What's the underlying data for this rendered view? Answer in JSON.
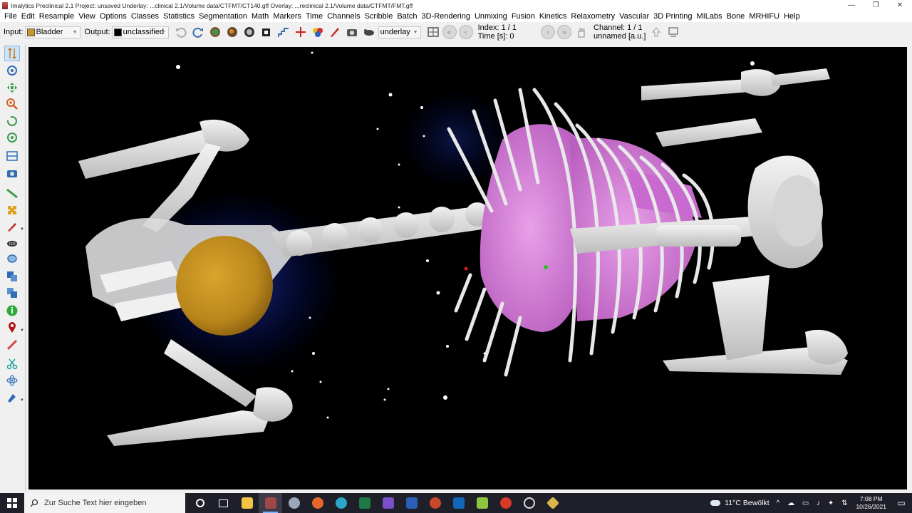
{
  "window": {
    "title": "Imalytics Preclinical 2.1 Project: unsaved   Underlay: ...clinical 2.1/Volume data/CTFMT/CT140.gff   Overlay: ...reclinical 2.1/Volume data/CTFMT/FMT.gff",
    "controls": [
      "—",
      "❐",
      "✕"
    ]
  },
  "menu": [
    "File",
    "Edit",
    "Resample",
    "View",
    "Options",
    "Classes",
    "Statistics",
    "Segmentation",
    "Math",
    "Markers",
    "Time",
    "Channels",
    "Scribble",
    "Batch",
    "3D-Rendering",
    "Unmixing",
    "Fusion",
    "Kinetics",
    "Relaxometry",
    "Vascular",
    "3D Printing",
    "MILabs",
    "Bone",
    "MRHIFU",
    "Help"
  ],
  "toolbar": {
    "input_label": "Input:",
    "input_value": "Bladder",
    "input_color": "#c8962c",
    "output_label": "Output:",
    "output_value": "unclassified",
    "output_color": "#000000",
    "layer_value": "underlay",
    "index_text": "Index: 1 / 1",
    "time_text": "Time [s]: 0",
    "channel_text": "Channel: 1 / 1",
    "unit_text": "unnamed [a.u.]"
  },
  "left_tools": [
    "move-icon",
    "crosshair-icon",
    "pan-icon",
    "zoom-icon",
    "rotate-icon",
    "rotate3d-icon",
    "slice-icon",
    "camera-icon",
    "ruler-icon",
    "puzzle-icon",
    "pencil-icon",
    "iso-icon",
    "lasso-icon",
    "copy-classes-icon",
    "merge-icon",
    "info-icon",
    "marker-icon",
    "measure-icon",
    "scissors-icon",
    "atom-icon",
    "brush-icon"
  ],
  "taskbar": {
    "search_placeholder": "Zur Suche Text hier eingeben",
    "weather": "11°C  Bewölkt",
    "time": "7:08 PM",
    "date": "10/26/2021"
  },
  "colors": {
    "bone": "#e6e6e6",
    "lung": "#d77fd9",
    "bladder": "#c8961e",
    "viewer_bg": "#000000"
  }
}
